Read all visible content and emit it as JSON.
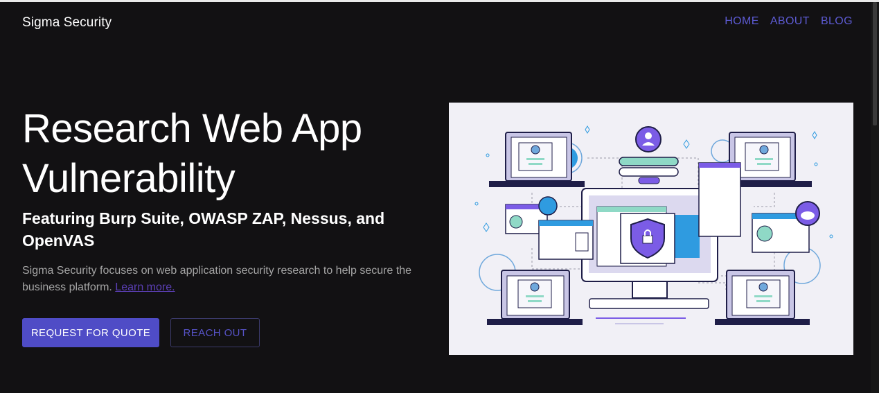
{
  "header": {
    "brand": "Sigma Security",
    "nav": [
      {
        "label": "HOME"
      },
      {
        "label": "ABOUT"
      },
      {
        "label": "BLOG"
      }
    ]
  },
  "hero": {
    "title_line1": "Research Web App",
    "title_line2": "Vulnerability",
    "subtitle": "Featuring Burp Suite, OWASP ZAP, Nessus, and OpenVAS",
    "description": "Sigma Security focuses on web application security research to help secure the business platform.",
    "learn_more": "Learn more.",
    "primary_button": "REQUEST FOR QUOTE",
    "secondary_button": "REACH OUT"
  },
  "colors": {
    "background": "#121113",
    "accent": "#4f4cc6",
    "nav_link": "#5d5bd4",
    "illustration_bg": "#f1f0f6",
    "illustration_purple": "#7b5ce6",
    "illustration_teal": "#8fd9c6",
    "illustration_blue": "#2f9be0",
    "illustration_navy": "#1f1e48"
  }
}
